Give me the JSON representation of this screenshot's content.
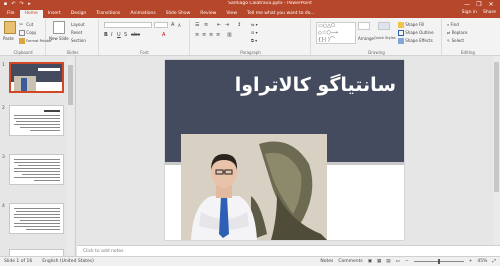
{
  "titlebar": {
    "title": "Santiago Calatrava.pptx - PowerPoint",
    "minimize": "—",
    "maximize": "❐",
    "close": "✕"
  },
  "tabs": [
    "File",
    "Home",
    "Insert",
    "Design",
    "Transitions",
    "Animations",
    "Slide Show",
    "Review",
    "View",
    "Tell me what you want to do..."
  ],
  "active_tab": "Home",
  "tabs_right": {
    "signin": "Sign in",
    "share": "Share"
  },
  "ribbon": {
    "clipboard": {
      "paste": "Paste",
      "cut": "Cut",
      "copy": "Copy",
      "format_painter": "Format Painter",
      "label": "Clipboard"
    },
    "slides": {
      "new_slide": "New Slide",
      "layout": "Layout",
      "reset": "Reset",
      "section": "Section",
      "label": "Slides"
    },
    "font": {
      "label": "Font"
    },
    "paragraph": {
      "label": "Paragraph"
    },
    "drawing": {
      "arrange": "Arrange",
      "quick_styles": "Quick Styles",
      "shape_fill": "Shape Fill",
      "shape_outline": "Shape Outline",
      "shape_effects": "Shape Effects",
      "label": "Drawing"
    },
    "editing": {
      "find": "Find",
      "replace": "Replace",
      "select": "Select",
      "label": "Editing"
    }
  },
  "thumbnails": {
    "numbers": [
      "1",
      "2",
      "3",
      "4"
    ]
  },
  "slide": {
    "title": "سانتیاگو کالاتراوا"
  },
  "notes": {
    "placeholder": "Click to add notes"
  },
  "status": {
    "slide_of": "Slide 1 of 16",
    "language": "English (United States)",
    "notes": "Notes",
    "comments": "Comments",
    "zoom": "45%"
  }
}
